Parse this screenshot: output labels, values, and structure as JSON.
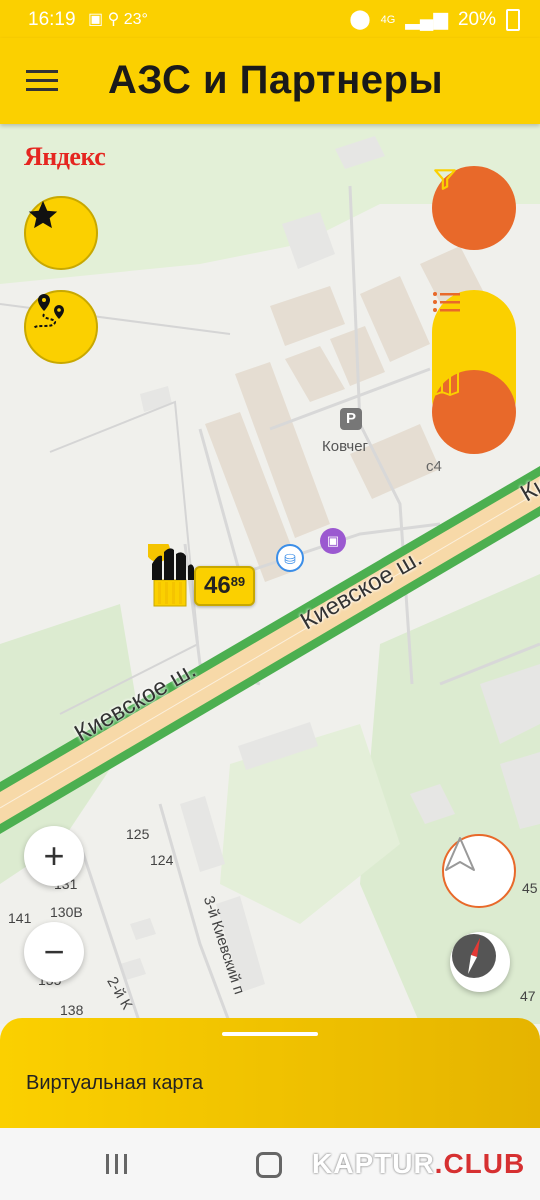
{
  "status_bar": {
    "time": "16:19",
    "temperature": "23°",
    "network": "4G",
    "battery": "20%"
  },
  "app_bar": {
    "title": "АЗС и Партнеры",
    "menu_icon": "hamburger-menu-icon"
  },
  "map": {
    "provider_logo": "Яндекс",
    "road_labels": [
      "Киевское ш.",
      "Киевское ш.",
      "Ки"
    ],
    "side_street_label": "3-й Киевский п",
    "side_street_label_2": "2-й К",
    "poi_parking": "P",
    "poi_name": "Ковчег",
    "building_c4": "с4",
    "house_numbers": [
      "125",
      "124",
      "131",
      "130В",
      "141",
      "135",
      "138",
      "45",
      "47"
    ],
    "gas_station": {
      "brand_icon": "rosneft-logo-icon",
      "price_main": "46",
      "price_cents": "89"
    }
  },
  "controls": {
    "favorites_icon": "star-icon",
    "route_icon": "route-icon",
    "filter_icon": "filter-icon",
    "list_icon": "list-icon",
    "map_icon": "map-icon",
    "zoom_in_label": "+",
    "zoom_out_label": "−",
    "navigation_icon": "navigation-arrow-icon",
    "compass_icon": "compass-icon"
  },
  "bottom_sheet": {
    "title": "Виртуальная карта"
  },
  "watermark": {
    "part_a": "KAPTUR",
    "part_b": ".CLUB"
  },
  "colors": {
    "brand_yellow": "#fbd000",
    "accent_orange": "#e8692a",
    "road_green": "#4caf50",
    "road_fill": "#f7d9a8"
  }
}
